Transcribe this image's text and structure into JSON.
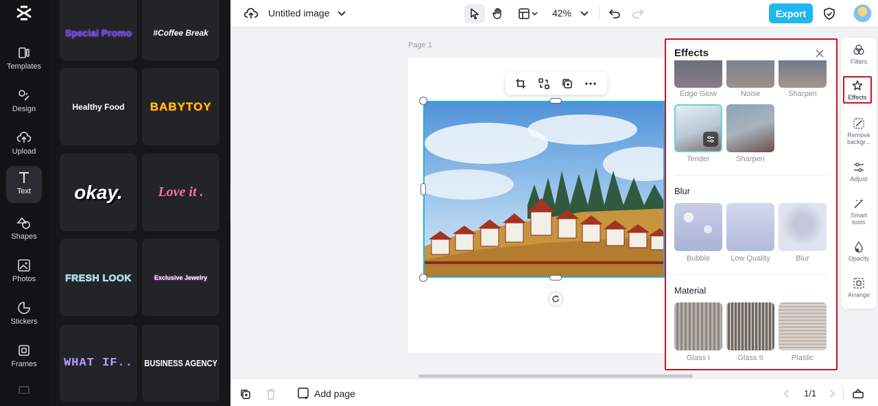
{
  "app": {
    "doc_title": "Untitled image",
    "zoom": "42%",
    "export_label": "Export"
  },
  "rail": {
    "items": [
      {
        "label": "Templates",
        "icon": "templates-icon"
      },
      {
        "label": "Design",
        "icon": "design-icon"
      },
      {
        "label": "Upload",
        "icon": "upload-icon"
      },
      {
        "label": "Text",
        "icon": "text-icon",
        "active": true
      },
      {
        "label": "Shapes",
        "icon": "shapes-icon"
      },
      {
        "label": "Photos",
        "icon": "photos-icon"
      },
      {
        "label": "Stickers",
        "icon": "stickers-icon"
      },
      {
        "label": "Frames",
        "icon": "frames-icon"
      }
    ]
  },
  "text_templates": [
    {
      "text": "Special Promo",
      "color": "#6d3cf0"
    },
    {
      "text": "#Coffee Break",
      "color": "#ffffff"
    },
    {
      "text": "Healthy Food",
      "color": "#ffffff"
    },
    {
      "text": "BABYTOY",
      "color": "#ffcc00"
    },
    {
      "text": "okay.",
      "color": "#ffffff"
    },
    {
      "text": "Love it .",
      "color": "#ff6fa5"
    },
    {
      "text": "FRESH LOOK",
      "color": "#5ad9ff"
    },
    {
      "text": "Exclusive Jewelry",
      "color": "#ffffff"
    },
    {
      "text": "WHAT IF..",
      "color": "#b99cff"
    },
    {
      "text": "BUSINESS AGENCY",
      "color": "#ffffff"
    }
  ],
  "canvas": {
    "page_label": "Page 1"
  },
  "effects_panel": {
    "title": "Effects",
    "top_row": [
      "Edge Glow",
      "Noise",
      "Sharpen"
    ],
    "row2": [
      "Tender",
      "Sharpen"
    ],
    "blur_title": "Blur",
    "blur": [
      "Bubble",
      "Low Quality",
      "Blur"
    ],
    "material_title": "Material",
    "material": [
      "Glass I",
      "Glass II",
      "Plastic"
    ]
  },
  "right_tools": [
    {
      "label": "Filters",
      "icon": "filters-icon"
    },
    {
      "label": "Effects",
      "icon": "effects-icon",
      "active": true
    },
    {
      "label": "Remove backgr...",
      "icon": "remove-background-icon"
    },
    {
      "label": "Adjust",
      "icon": "adjust-icon"
    },
    {
      "label": "Smart tools",
      "icon": "smart-tools-icon"
    },
    {
      "label": "Opacity",
      "icon": "opacity-icon"
    },
    {
      "label": "Arrange",
      "icon": "arrange-icon"
    }
  ],
  "bottom": {
    "add_page": "Add page",
    "pager": "1/1"
  },
  "colors": {
    "accent": "#1fb6f1",
    "selection": "#21b5d9",
    "highlight_box": "#d0101e"
  }
}
